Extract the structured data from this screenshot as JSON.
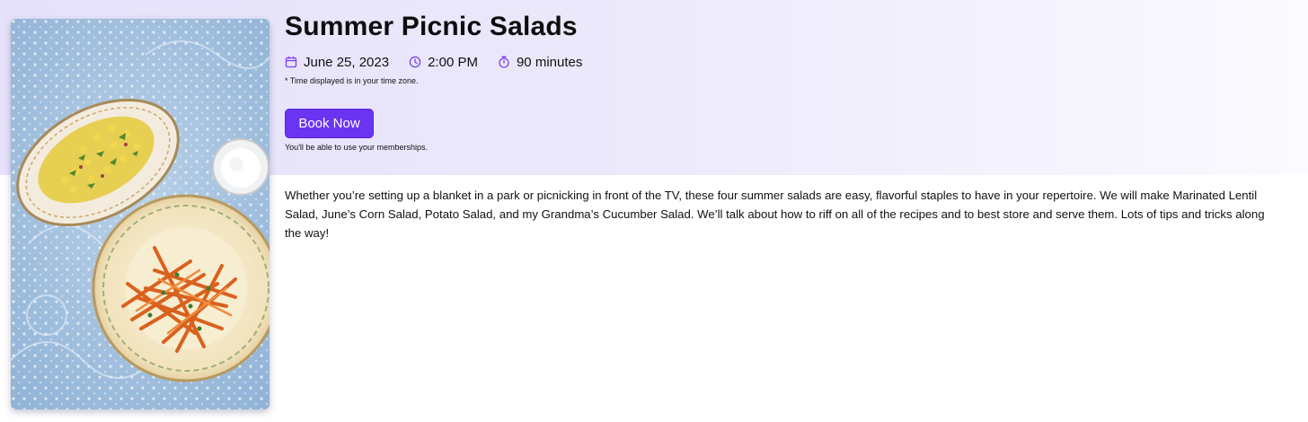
{
  "event": {
    "title": "Summer Picnic Salads",
    "date": "June 25, 2023",
    "time": "2:00 PM",
    "duration": "90 minutes",
    "timezone_note": "* Time displayed is in your time zone.",
    "book_label": "Book Now",
    "membership_note": "You'll be able to use your memberships.",
    "description": "Whether you’re setting up a blanket in a park or picnicking in front of the TV, these four summer salads are easy, flavorful staples to have in your repertoire. We will make Marinated Lentil Salad, June’s Corn Salad, Potato Salad, and my Grandma’s Cucumber Salad. We’ll talk about how to riff on all of the recipes and to best store and serve them. Lots of tips and tricks along the way!"
  },
  "icons": {
    "date": "calendar-icon",
    "time": "clock-icon",
    "duration": "stopwatch-icon"
  },
  "colors": {
    "accent": "#6b33f2",
    "icon": "#7a3df0",
    "header_band": "#e8e5fb",
    "text": "#111111"
  }
}
